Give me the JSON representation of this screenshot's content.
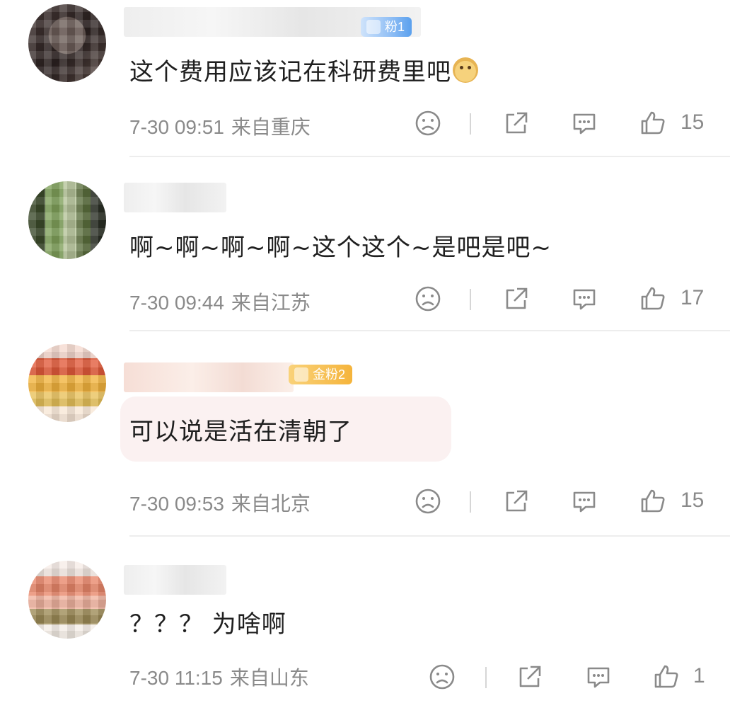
{
  "comments": [
    {
      "badge": "粉1",
      "text": "这个费用应该记在科研费里吧",
      "has_emoji": true,
      "emoji_icon": "doge-emoji-icon",
      "time": "7-30 09:51",
      "location": "来自重庆",
      "likes": "15"
    },
    {
      "badge": "",
      "text": "啊~啊~啊~啊~这个这个~是吧是吧~",
      "has_emoji": false,
      "time": "7-30 09:44",
      "location": "来自江苏",
      "likes": "17"
    },
    {
      "badge": "金粉2",
      "text": "可以说是活在清朝了",
      "has_emoji": false,
      "highlighted": true,
      "time": "7-30 09:53",
      "location": "来自北京",
      "likes": "15"
    },
    {
      "badge": "",
      "text": "？？？ 为啥啊",
      "has_emoji": false,
      "time": "7-30 11:15",
      "location": "来自山东",
      "likes": "1"
    }
  ],
  "icons": {
    "dislike": "sad-face-icon",
    "share": "share-icon",
    "reply": "comment-bubble-icon",
    "like": "thumbs-up-icon"
  },
  "colors": {
    "meta_text": "#8a8a8a",
    "highlight_bg": "#fbf1f1",
    "fan_badge_blue": "#5aa0ee",
    "fan_badge_gold": "#f5b43b"
  }
}
